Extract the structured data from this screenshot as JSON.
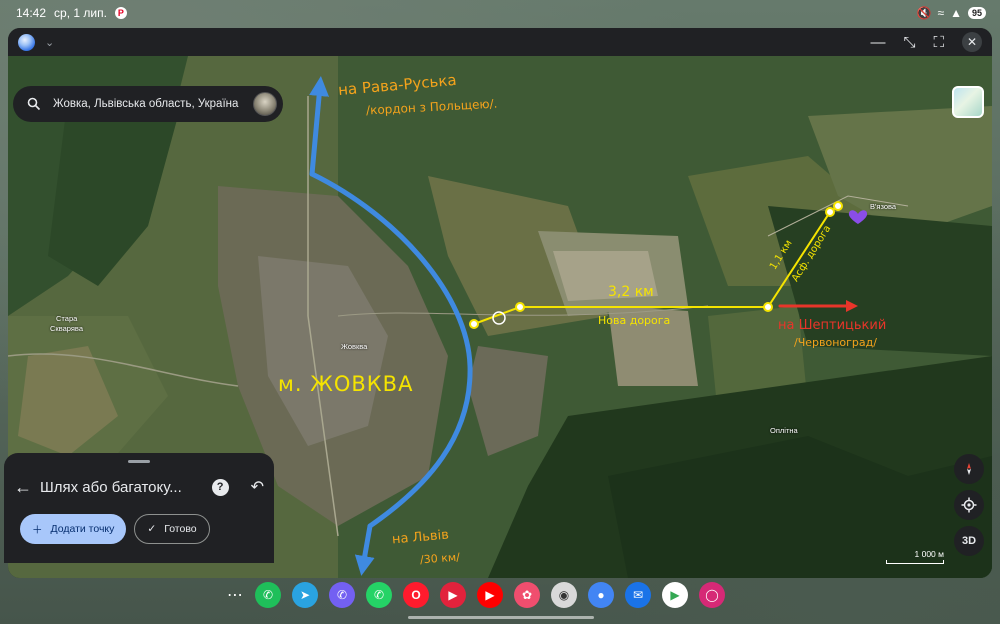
{
  "status_bar": {
    "time": "14:42",
    "date": "ср, 1 лип.",
    "battery": "95"
  },
  "search": {
    "query": "Жовка, Львівська область, Україна"
  },
  "map": {
    "labels": {
      "rava_line1": "на Рава-Руська",
      "rava_line2": "/кордон з Польщею/.",
      "zhovkva": "м. ЖОВКВА",
      "lviv_line1": "на Львів",
      "lviv_line2": "/30 км/",
      "distance": "3,2 км",
      "new_road": "Нова дорога",
      "asphalt_distance": "1,1 км",
      "asphalt_road": "Асф. дорога",
      "sheptytskyi_line1": "на Шептицький",
      "sheptytskyi_line2": "/Червоноград/"
    },
    "places": {
      "stara_skvaryava_1": "Стара",
      "stara_skvaryava_2": "Скварява",
      "zhovkva_small": "Жовква",
      "vyazova": "В'язова",
      "oplitna": "Оплітна"
    },
    "scale": "1 000 м",
    "three_d": "3D"
  },
  "sheet": {
    "title": "Шлях або багатоку...",
    "add_point": "Додати точку",
    "done": "Готово"
  },
  "colors": {
    "route_blue": "#3f8ae0",
    "measure_yellow": "#f5e400",
    "arrow_red": "#e8352a",
    "label_orange": "#f4a31c",
    "marker_purple": "#8a4de8"
  }
}
